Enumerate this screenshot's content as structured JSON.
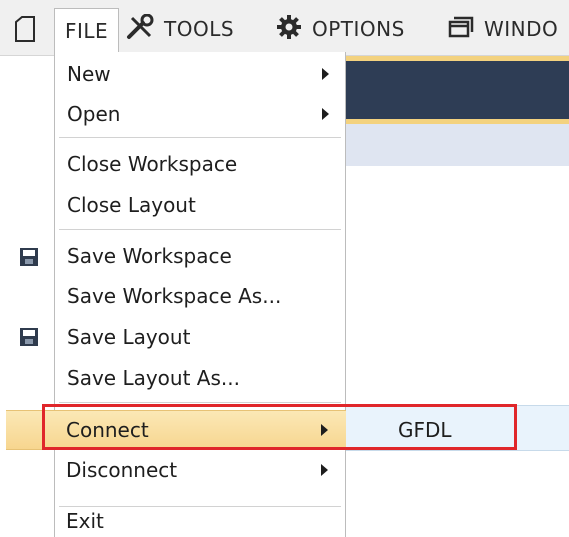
{
  "menubar": {
    "items": [
      {
        "label": "FILE",
        "icon": "new-doc-icon"
      },
      {
        "label": "TOOLS",
        "icon": "tools-icon"
      },
      {
        "label": "OPTIONS",
        "icon": "gear-icon"
      },
      {
        "label": "WINDO",
        "icon": "window-icon"
      }
    ]
  },
  "file_menu": {
    "items": {
      "new": {
        "label": "New"
      },
      "open": {
        "label": "Open"
      },
      "close_workspace": {
        "label": "Close Workspace"
      },
      "close_layout": {
        "label": "Close Layout"
      },
      "save_workspace": {
        "label": "Save Workspace",
        "icon": "save-icon"
      },
      "save_workspace_as": {
        "label": "Save Workspace As..."
      },
      "save_layout": {
        "label": "Save Layout",
        "icon": "save-layout-icon"
      },
      "save_layout_as": {
        "label": "Save Layout As..."
      },
      "connect": {
        "label": "Connect"
      },
      "disconnect": {
        "label": "Disconnect"
      },
      "exit": {
        "label": "Exit"
      }
    }
  },
  "connect_submenu": {
    "items": [
      {
        "label": "GFDL"
      }
    ]
  },
  "colors": {
    "highlight": "#f7d68f",
    "annotation_box": "#e0262a",
    "submenu_bg": "#e9f3fc",
    "app_band": "#2e3d55",
    "app_band_accent": "#f3d27f"
  }
}
